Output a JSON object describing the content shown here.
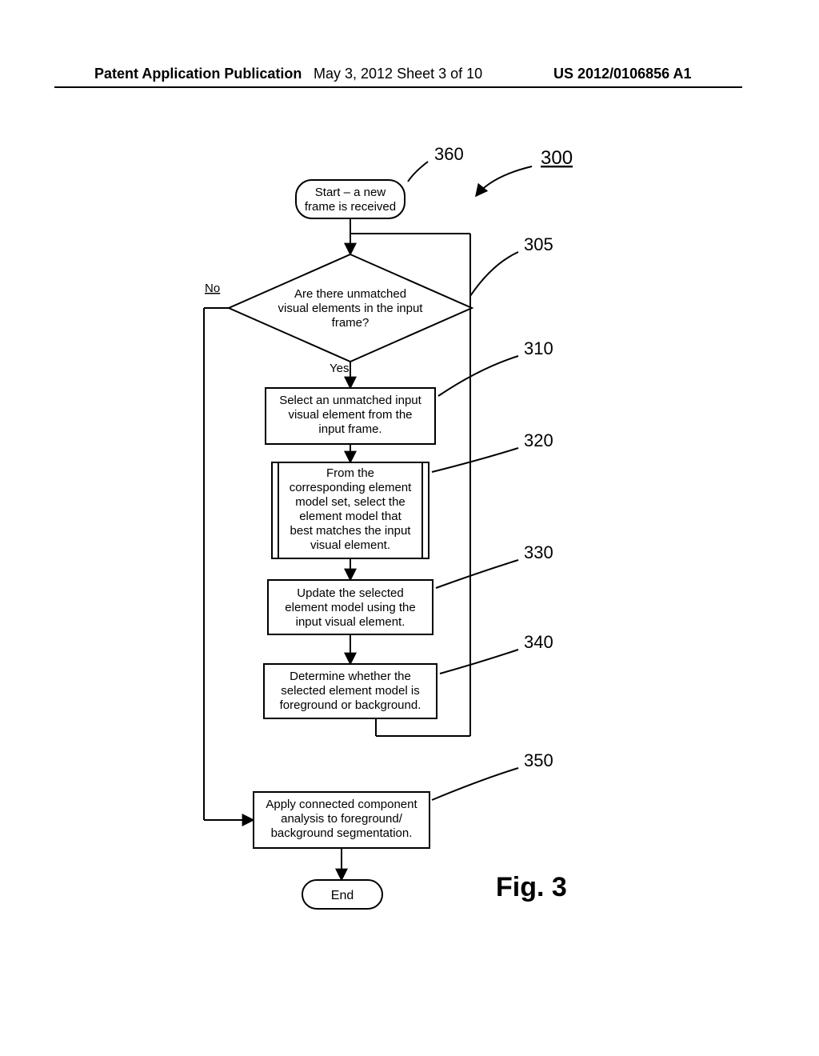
{
  "header": {
    "left": "Patent Application Publication",
    "center": "May 3, 2012   Sheet 3 of 10",
    "right": "US 2012/0106856 A1"
  },
  "figure": {
    "ref_overall": "300",
    "labels": {
      "start": "360",
      "decision": "305",
      "select_unmatched": "310",
      "select_model": "320",
      "update_model": "330",
      "determine_fg_bg": "340",
      "connected_comp": "350"
    },
    "nodes": {
      "start": "Start – a new\nframe is received",
      "decision": "Are there unmatched\nvisual elements in the input\nframe?",
      "yes": "Yes",
      "no": "No",
      "select_unmatched": "Select an unmatched input\nvisual element from the\ninput frame.",
      "select_model": "From the\ncorresponding element\nmodel set, select the\nelement model that\nbest matches the input\nvisual element.",
      "update_model": "Update the selected\nelement model using the\ninput visual element.",
      "determine_fg_bg": "Determine whether the\nselected element model is\nforeground or background.",
      "connected_comp": "Apply connected component\nanalysis to foreground/\nbackground segmentation.",
      "end": "End"
    },
    "caption": "Fig. 3"
  }
}
